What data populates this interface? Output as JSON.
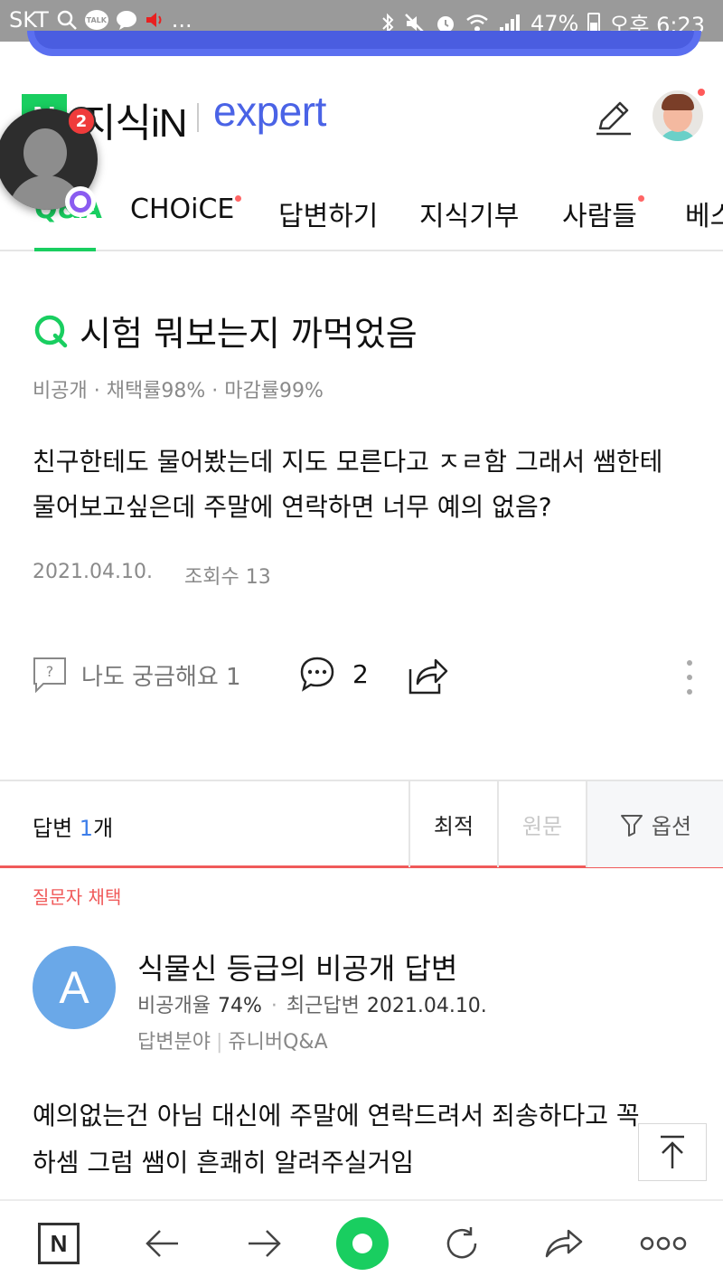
{
  "status_bar": {
    "carrier": "SKT",
    "talk_label": "TALK",
    "more": "...",
    "battery": "47%",
    "time": "오후 6:23"
  },
  "header": {
    "logo_n": "N",
    "logo_text": "지식iN",
    "logo_expert": "expert"
  },
  "chathead": {
    "badge_count": "2"
  },
  "tabs": [
    {
      "label": "Q&A",
      "active": true
    },
    {
      "label": "CHOiCE",
      "dot": true
    },
    {
      "label": "답변하기"
    },
    {
      "label": "지식기부"
    },
    {
      "label": "사람들",
      "dot": true
    },
    {
      "label": "베스"
    }
  ],
  "question": {
    "title": "시험 뭐보는지 까먹었음",
    "meta": "비공개 · 채택률98% · 마감률99%",
    "body": "친구한테도 물어봤는데 지도 모른다고 ㅈㄹ함 그래서 쌤한테 물어보고싶은데 주말에 연락하면 너무 예의 없음?",
    "date": "2021.04.10.",
    "views": "조회수 13",
    "curious_label": "나도 궁금해요 1",
    "comment_count": "2"
  },
  "answers_bar": {
    "label_prefix": "답변 ",
    "count": "1",
    "label_suffix": "개",
    "sort_best": "최적",
    "sort_original": "원문",
    "options": "옵션"
  },
  "answer": {
    "adopted_label": "질문자 채택",
    "avatar_letter": "A",
    "name": "식물신 등급의 비공개 답변",
    "private_rate_label": "비공개율",
    "private_rate": "74%",
    "recent_label": "최근답변",
    "recent_date": "2021.04.10.",
    "field_label": "답변분야",
    "field_value": "쥬니버Q&A",
    "body": "예의없는건 아님 대신에 주말에 연락드려서 죄송하다고 꼭 하셈 그럼 쌤이 흔쾌히 알려주실거임"
  },
  "bottom_nav": {
    "home_label": "N"
  },
  "colors": {
    "naver_green": "#19ce60",
    "expert_blue": "#4a63e6",
    "adopted_red": "#f05a5a",
    "answer_count_blue": "#3d7eea",
    "avatar_blue": "#6aa8e8"
  }
}
